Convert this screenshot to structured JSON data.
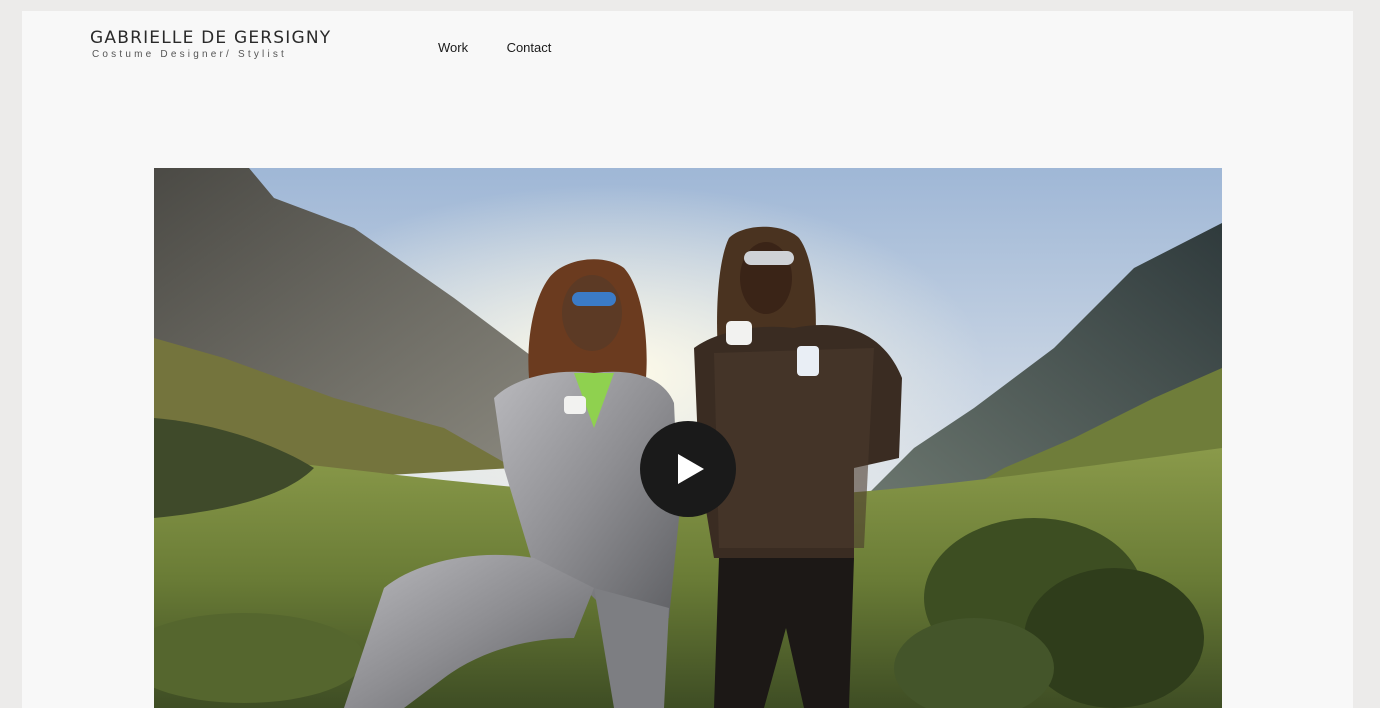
{
  "brand": {
    "name": "GABRIELLE DE GERSIGNY",
    "subtitle": "Costume Designer/ Stylist"
  },
  "nav": {
    "items": [
      {
        "label": "Work"
      },
      {
        "label": "Contact"
      }
    ]
  },
  "video": {
    "play_icon": "play-icon",
    "overlay_color": "#1a1a1a"
  },
  "colors": {
    "page_background": "#f8f8f8",
    "outer_background": "#ecebea",
    "text": "#1a1a1a"
  }
}
